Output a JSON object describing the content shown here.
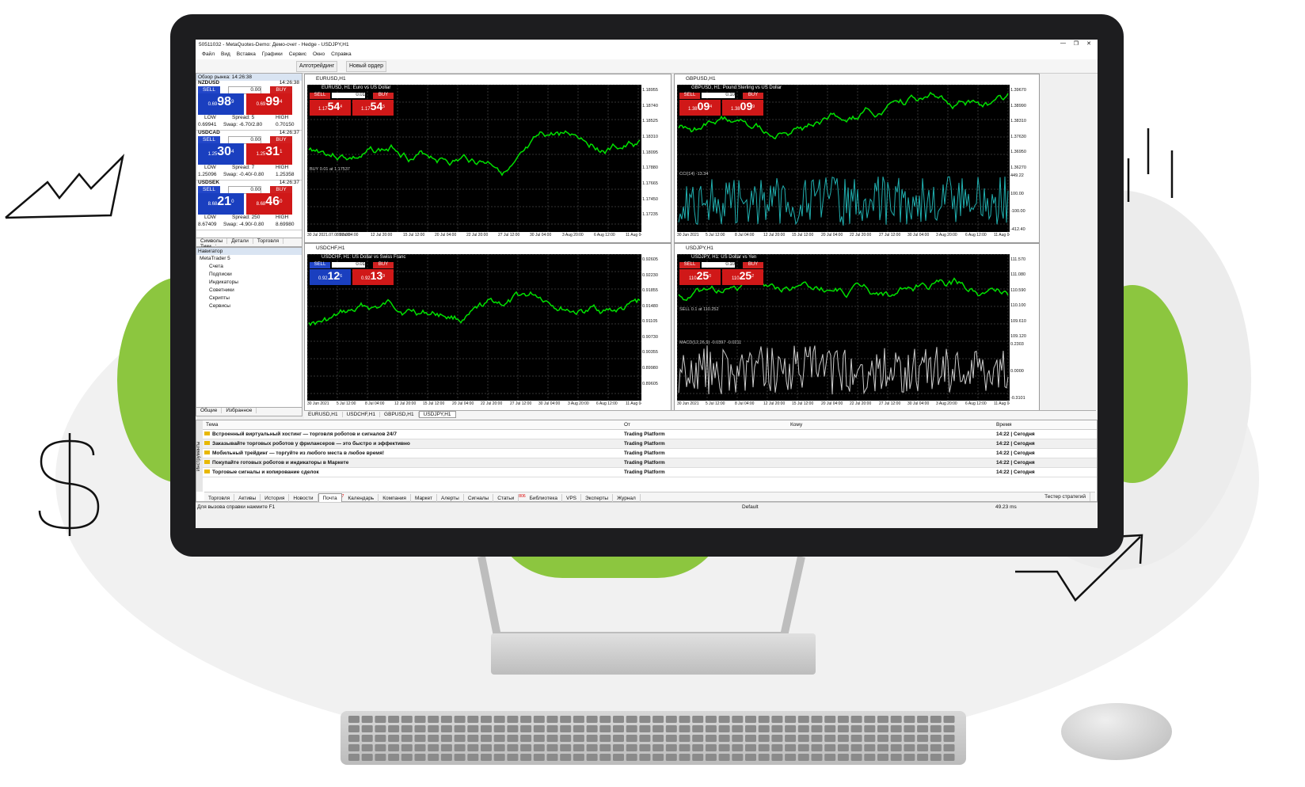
{
  "window": {
    "title": "50511032 - MetaQuotes-Demo: Демо-счет - Hedge - USDJPY,H1"
  },
  "menu": [
    "Файл",
    "Вид",
    "Вставка",
    "Графики",
    "Сервис",
    "Окно",
    "Справка"
  ],
  "toolbar": {
    "algo_label": "Алготрейдинг",
    "new_order_label": "Новый ордер"
  },
  "market_watch": {
    "header": "Обзор рынка: 14:26:38",
    "quotes": [
      {
        "symbol": "NZDUSD",
        "time": "14:26:38",
        "sell": "SELL",
        "buy": "BUY",
        "volume": "0.00",
        "sell_prefix": "0.69",
        "sell_big": "98",
        "sell_sup": "9",
        "buy_prefix": "0.69",
        "buy_big": "99",
        "buy_sup": "4",
        "low_label": "LOW",
        "high_label": "HIGH",
        "spread": "Spread: 5",
        "swap": "Swap: -6.70/2.80",
        "low": "0.69941",
        "high": "0.70150"
      },
      {
        "symbol": "USDCAD",
        "time": "14:26:37",
        "sell": "SELL",
        "buy": "BUY",
        "volume": "0.00",
        "sell_prefix": "1.25",
        "sell_big": "30",
        "sell_sup": "4",
        "buy_prefix": "1.25",
        "buy_big": "31",
        "buy_sup": "1",
        "low_label": "LOW",
        "high_label": "HIGH",
        "spread": "Spread: 7",
        "swap": "Swap: -0.40/-0.80",
        "low": "1.25096",
        "high": "1.25358"
      },
      {
        "symbol": "USDSEK",
        "time": "14:26:37",
        "sell": "SELL",
        "buy": "BUY",
        "volume": "0.00",
        "sell_prefix": "8.68",
        "sell_big": "21",
        "sell_sup": "0",
        "buy_prefix": "8.68",
        "buy_big": "46",
        "buy_sup": "0",
        "low_label": "LOW",
        "high_label": "HIGH",
        "spread": "Spread: 250",
        "swap": "Swap: -4.90/-0.80",
        "low": "8.67409",
        "high": "8.69980"
      }
    ],
    "tabs": [
      "Символы",
      "Детали",
      "Торговля",
      "Тики"
    ]
  },
  "navigator": {
    "header": "Навигатор",
    "root": "MetaTrader 5",
    "items": [
      "Счета",
      "Подписки",
      "Индикаторы",
      "Советники",
      "Скрипты",
      "Сервисы"
    ],
    "tabs": [
      "Общие",
      "Избранное"
    ]
  },
  "charts": [
    {
      "title": "EURUSD,H1",
      "subtitle": "EURUSD, H1: Euro vs US Dollar",
      "lot": "0.01",
      "sell_prefix": "1.17",
      "sell_big": "54",
      "sell_sup": "4",
      "buy_prefix": "1.17",
      "buy_big": "54",
      "buy_sup": "5",
      "line_label": "BUY 0.01 at 1.17537",
      "prices": [
        "1.18955",
        "1.18740",
        "1.18525",
        "1.18310",
        "1.18095",
        "1.17880",
        "1.17665",
        "1.17450",
        "1.17235"
      ],
      "dates": [
        "30 Jul 2021.07.08 08:00",
        "9 Jul 04:00",
        "12 Jul 20:00",
        "15 Jul 12:00",
        "20 Jul 04:00",
        "22 Jul 20:00",
        "27 Jul 12:00",
        "30 Jul 04:00",
        "3 Aug 20:00",
        "6 Aug 12:00",
        "11 Aug 04:00"
      ]
    },
    {
      "title": "GBPUSD,H1",
      "subtitle": "GBPUSD, H1: Pound Sterling vs US Dollar",
      "lot": "0.10",
      "sell_prefix": "1.38",
      "sell_big": "09",
      "sell_sup": "4",
      "buy_prefix": "1.38",
      "buy_big": "09",
      "buy_sup": "9",
      "indicator": "CCI(14) -13.34",
      "prices": [
        "1.39670",
        "1.38990",
        "1.38310",
        "1.37630",
        "1.36950",
        "1.36270"
      ],
      "ind_levels": [
        "449.22",
        "100.00",
        "-100.00",
        "-412.40"
      ],
      "dates": [
        "30 Jun 2021",
        "5 Jul 12:00",
        "8 Jul 04:00",
        "12 Jul 20:00",
        "15 Jul 12:00",
        "20 Jul 04:00",
        "22 Jul 20:00",
        "27 Jul 12:00",
        "30 Jul 04:00",
        "3 Aug 20:00",
        "6 Aug 12:00",
        "11 Aug 04:00"
      ]
    },
    {
      "title": "USDCHF,H1",
      "subtitle": "USDCHF, H1: US Dollar vs Swiss Franc",
      "lot": "0.01",
      "sell_prefix": "0.92",
      "sell_big": "12",
      "sell_sup": "6",
      "buy_prefix": "0.92",
      "buy_big": "13",
      "buy_sup": "9",
      "prices": [
        "0.92605",
        "0.92230",
        "0.91855",
        "0.91480",
        "0.91105",
        "0.90730",
        "0.90355",
        "0.89980",
        "0.89605"
      ],
      "dates": [
        "30 Jun 2021",
        "5 Jul 12:00",
        "8 Jul 04:00",
        "12 Jul 20:00",
        "15 Jul 12:00",
        "20 Jul 04:00",
        "22 Jul 20:00",
        "27 Jul 12:00",
        "30 Jul 04:00",
        "3 Aug 20:00",
        "6 Aug 12:00",
        "11 Aug 04:00"
      ]
    },
    {
      "title": "USDJPY,H1",
      "subtitle": "USDJPY, H1: US Dollar vs Yen",
      "lot": "0.10",
      "sell_prefix": "110",
      "sell_big": "25",
      "sell_sup": "0",
      "buy_prefix": "110",
      "buy_big": "25",
      "buy_sup": "2",
      "line_label": "SELL 0.1 at 110.252",
      "indicator": "MACD(12,26,9) -0.0397 -0.0211",
      "prices": [
        "111.570",
        "111.080",
        "110.590",
        "110.100",
        "109.610",
        "109.120"
      ],
      "ind_levels": [
        "0.2303",
        "0.0000",
        "-0.3101"
      ],
      "dates": [
        "30 Jun 2021",
        "5 Jul 12:00",
        "8 Jul 04:00",
        "12 Jul 20:00",
        "15 Jul 12:00",
        "20 Jul 04:00",
        "22 Jul 20:00",
        "27 Jul 12:00",
        "30 Jul 04:00",
        "3 Aug 20:00",
        "6 Aug 12:00",
        "11 Aug 04:00"
      ]
    }
  ],
  "chart_tabs": [
    "EURUSD,H1",
    "USDCHF,H1",
    "GBPUSD,H1",
    "USDJPY,H1"
  ],
  "mailbox": {
    "columns": [
      "Тема",
      "От",
      "Кому",
      "Время"
    ],
    "rows": [
      {
        "subject": "Встроенный виртуальный хостинг — торговля роботов и сигналов 24/7",
        "from": "Trading Platform",
        "to": "",
        "time": "14:22 | Сегодня"
      },
      {
        "subject": "Заказывайте торговых роботов у фрилансеров — это быстро и эффективно",
        "from": "Trading Platform",
        "to": "",
        "time": "14:22 | Сегодня"
      },
      {
        "subject": "Мобильный трейдинг — торгуйте из любого места в любое время!",
        "from": "Trading Platform",
        "to": "",
        "time": "14:22 | Сегодня"
      },
      {
        "subject": "Покупайте готовых роботов и индикаторы в Маркете",
        "from": "Trading Platform",
        "to": "",
        "time": "14:22 | Сегодня"
      },
      {
        "subject": "Торговые сигналы и копирование сделок",
        "from": "Trading Platform",
        "to": "",
        "time": "14:22 | Сегодня"
      }
    ],
    "side_label": "Инструменты",
    "tabs": [
      "Торговля",
      "Активы",
      "История",
      "Новости",
      "Почта",
      "Календарь",
      "Компания",
      "Маркет",
      "Алерты",
      "Сигналы",
      "Статьи",
      "Библиотека",
      "VPS",
      "Эксперты",
      "Журнал"
    ],
    "mail_badge": "7",
    "articles_badge": "806",
    "tester": "Тестер стратегий"
  },
  "status": {
    "help": "Для вызова справки нажмите F1",
    "profile": "Default",
    "ping": "49.23 ms"
  },
  "colors": {
    "green_accent": "#8cc63f",
    "sell_blue": "#1a3fbf",
    "buy_red": "#d01818",
    "chart_bg": "#000000",
    "candle": "#00e000"
  }
}
